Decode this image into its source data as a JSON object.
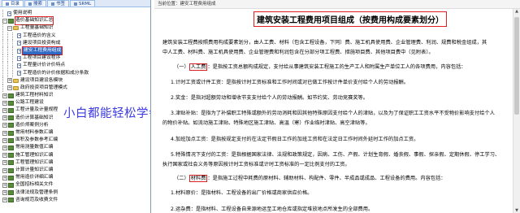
{
  "tabs": [
    {
      "label": "目录",
      "active": true
    },
    {
      "label": "搜索",
      "active": false
    },
    {
      "label": "书签",
      "active": false
    },
    {
      "label": "SRML",
      "active": false
    }
  ],
  "tree": [
    {
      "label": "使用说明",
      "indent": 1,
      "icon": "doc",
      "toggle": ""
    },
    {
      "label": "造价基础知识汇总",
      "indent": 0,
      "icon": "book",
      "toggle": "−",
      "boxed": true
    },
    {
      "label": "工程量基础知识",
      "indent": 1,
      "icon": "folder",
      "toggle": "−"
    },
    {
      "label": "工程造价的含义",
      "indent": 3,
      "icon": "doc",
      "toggle": ""
    },
    {
      "label": "建设项目投资构成",
      "indent": 3,
      "icon": "doc",
      "toggle": ""
    },
    {
      "label": "建安工程费用组成",
      "indent": 3,
      "icon": "doc",
      "toggle": "",
      "selected": true
    },
    {
      "label": "工程项目建设程序",
      "indent": 3,
      "icon": "doc",
      "toggle": ""
    },
    {
      "label": "工程量计价计价特点",
      "indent": 3,
      "icon": "doc",
      "toggle": ""
    },
    {
      "label": "工程造价的计价依据和成分条款",
      "indent": 3,
      "icon": "doc",
      "toggle": ""
    },
    {
      "label": "建设项目建设各模块",
      "indent": 1,
      "icon": "folder",
      "toggle": "+"
    },
    {
      "label": "政府投资项目管理模式",
      "indent": 1,
      "icon": "folder",
      "toggle": "+"
    },
    {
      "label": "建筑工程材料知识",
      "indent": 0,
      "icon": "book",
      "toggle": "+"
    },
    {
      "label": "公路工程建设",
      "indent": 0,
      "icon": "book",
      "toggle": "+"
    },
    {
      "label": "工程计量及计量规程",
      "indent": 0,
      "icon": "book",
      "toggle": "+"
    },
    {
      "label": "造价计算基础知识",
      "indent": 0,
      "icon": "book",
      "toggle": "+"
    },
    {
      "label": "造价师案例分析",
      "indent": 0,
      "icon": "book",
      "toggle": "+"
    },
    {
      "label": "常用材料参数汇编",
      "indent": 0,
      "icon": "book",
      "toggle": "+"
    },
    {
      "label": "面积及参数参考汇编",
      "indent": 0,
      "icon": "book",
      "toggle": "+"
    },
    {
      "label": "常用测量数值汇编",
      "indent": 0,
      "icon": "book",
      "toggle": "+"
    },
    {
      "label": "施工管理知识汇编",
      "indent": 0,
      "icon": "book",
      "toggle": "+"
    },
    {
      "label": "工程管理知识汇编",
      "indent": 0,
      "icon": "book",
      "toggle": "+"
    },
    {
      "label": "计算计量知识汇编",
      "indent": 0,
      "icon": "book",
      "toggle": "+"
    },
    {
      "label": "常用造价详细汇编",
      "indent": 0,
      "icon": "book",
      "toggle": "+"
    },
    {
      "label": "全国招标相关文件",
      "indent": 0,
      "icon": "book",
      "toggle": "+"
    },
    {
      "label": "法律法规及管理条例",
      "indent": 0,
      "icon": "book",
      "toggle": "+"
    },
    {
      "label": "咨询规范及收费文件",
      "indent": 0,
      "icon": "book",
      "toggle": "+"
    }
  ],
  "watermark": "小白都能轻松学会",
  "location": "当前位置：建安工程费用组成",
  "title": "建筑安装工程费用项目组成（按费用构成要素划分）",
  "paragraphs": [
    {
      "segments": [
        {
          "text": "建筑安装工程费按照费用构成要素划分，由人工费、材料（包含工程设备，下同）费、施工机具使用费、企业管理费、利润、规费和税金组成，其"
        }
      ]
    },
    {
      "segments": [
        {
          "text": "中人工费、材料费、施工机具使用费、企业管理费和利润包含在分部分项工程费、措施项目费、其他项目费中（见附表）。"
        }
      ]
    },
    {
      "segments": [
        {
          "text": "（一）"
        },
        {
          "text": "人工费",
          "hl": true
        },
        {
          "text": "：是指按工资总额构成规定，支付给从事建筑安装工程施工的生产工人和附属生产单位工人的各项费用，内容包括："
        }
      ]
    },
    {
      "segments": [
        {
          "text": "1.计时工资或计件工资：是指按计时工资标准和工作时间或对已做工作按计件单价支付给个人的劳动报酬。"
        }
      ]
    },
    {
      "segments": [
        {
          "text": "2.奖金：是指对超额劳动和增收节支支付给个人的劳动报酬。如节约奖、劳动竞赛奖等。"
        }
      ]
    },
    {
      "segments": [
        {
          "text": "3.津贴补贴：是指为了补偿职工特殊或额外的劳动消耗和因其他特殊原因支付给个人的津贴，以及为了保证职工工资水平不受物价影响支付给个人"
        }
      ]
    },
    {
      "segments": [
        {
          "text": "的物价补贴。如流动施工津贴、特殊地区施工津贴、高温（寒）作业临时津贴、高空津贴等。"
        }
      ]
    },
    {
      "segments": [
        {
          "text": "4.加班加点工资：是指按规定支付的在法定节假日工作的加班工资和在法定日工作时间外延时工作的加点工资。"
        }
      ]
    },
    {
      "segments": [
        {
          "text": "5.特殊情况下支付的工资：是指根据国家法律、法规和政策规定，因病、工伤、产假、计划生育假、婚丧假、事假、探亲假、定期休假、停工学习、"
        }
      ]
    },
    {
      "segments": [
        {
          "text": "执行国家或社会义务等原因按计时工资标准或计时工资标准的一定比例支付的工资。"
        }
      ]
    },
    {
      "segments": [
        {
          "text": "（二）"
        },
        {
          "text": "材料费",
          "hl": true
        },
        {
          "text": "：是指施工过程中耗费的原材料、辅助材料、构配件、零件、半成品或成品、工程设备的费用。内容包括："
        }
      ]
    },
    {
      "segments": [
        {
          "text": "1.材料原价：是指材料、工程设备的出厂价格或商家供应价格。"
        }
      ]
    },
    {
      "segments": [
        {
          "text": "2.运杂费：是指材料、工程设备自来源地运至工地仓库或指定堆放地点所发生的全部费用。"
        }
      ]
    }
  ]
}
